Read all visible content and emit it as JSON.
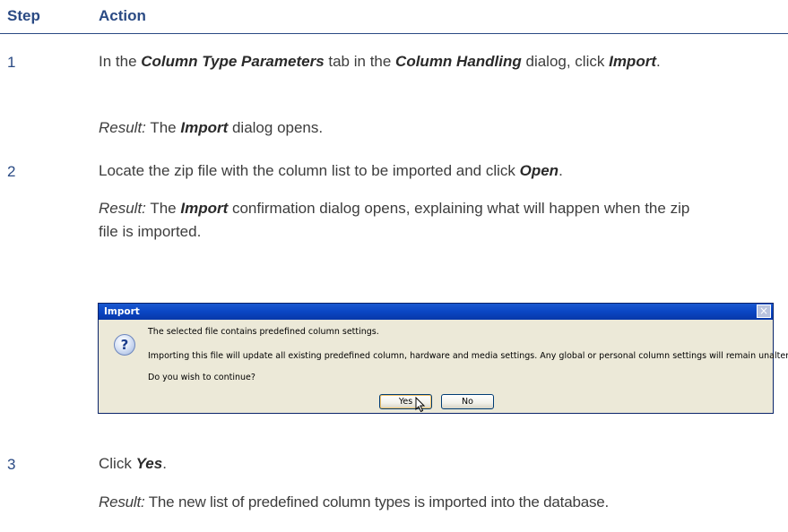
{
  "header": {
    "step": "Step",
    "action": "Action"
  },
  "steps": [
    {
      "number": "1",
      "instruction": {
        "t1": "In the ",
        "b1": "Column Type Parameters",
        "t2": " tab in the ",
        "b2": "Column Handling",
        "t3": " dialog, click ",
        "b3": "Import",
        "t4": "."
      },
      "result": {
        "label": "Result:",
        "t1": " The ",
        "b1": "Import",
        "t2": " dialog opens."
      }
    },
    {
      "number": "2",
      "instruction": {
        "t1": "Locate the zip file with the column list to be imported and click ",
        "b1": "Open",
        "t2": "."
      },
      "result": {
        "label": "Result:",
        "t1": " The ",
        "b1": "Import",
        "t2": " confirmation dialog opens, explaining what will happen when the zip file is imported."
      }
    },
    {
      "number": "3",
      "instruction": {
        "t1": "Click ",
        "b1": "Yes",
        "t2": "."
      },
      "result": {
        "label": "Result:",
        "t1": " The new list of predefined column types is imported into the database."
      }
    }
  ],
  "dialog": {
    "title": "Import",
    "close": "×",
    "icon": "question-icon",
    "icon_glyph": "?",
    "line1": "The selected file contains predefined column settings.",
    "line2": "Importing this file will update all existing predefined column, hardware and media settings. Any global or personal column settings will remain unaltered.",
    "line3": "Do you wish to continue?",
    "yes": "Yes",
    "no": "No"
  }
}
